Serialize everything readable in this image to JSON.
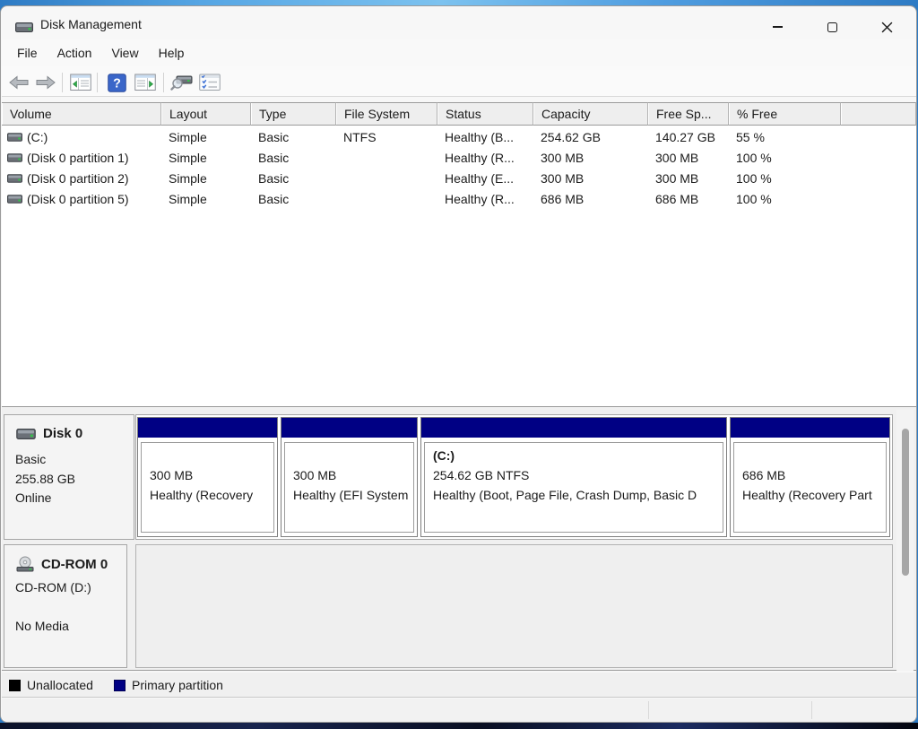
{
  "window": {
    "title": "Disk Management",
    "controls": {
      "minimize": "minimize",
      "maximize": "maximize",
      "close": "close"
    }
  },
  "menu": {
    "items": [
      {
        "label": "File"
      },
      {
        "label": "Action"
      },
      {
        "label": "View"
      },
      {
        "label": "Help"
      }
    ]
  },
  "toolbar": {
    "icons": [
      "back-icon",
      "forward-icon",
      "show-console-tree-icon",
      "help-icon",
      "show-action-pane-icon",
      "disk-search-icon",
      "checklist-icon"
    ]
  },
  "volume_table": {
    "columns": [
      {
        "label": "Volume"
      },
      {
        "label": "Layout"
      },
      {
        "label": "Type"
      },
      {
        "label": "File System"
      },
      {
        "label": "Status"
      },
      {
        "label": "Capacity"
      },
      {
        "label": "Free Sp..."
      },
      {
        "label": "% Free"
      }
    ],
    "rows": [
      {
        "volume": "(C:)",
        "layout": "Simple",
        "type": "Basic",
        "fs": "NTFS",
        "status": "Healthy (B...",
        "capacity": "254.62 GB",
        "free": "140.27 GB",
        "pct": "55 %"
      },
      {
        "volume": "(Disk 0 partition 1)",
        "layout": "Simple",
        "type": "Basic",
        "fs": "",
        "status": "Healthy (R...",
        "capacity": "300 MB",
        "free": "300 MB",
        "pct": "100 %"
      },
      {
        "volume": "(Disk 0 partition 2)",
        "layout": "Simple",
        "type": "Basic",
        "fs": "",
        "status": "Healthy (E...",
        "capacity": "300 MB",
        "free": "300 MB",
        "pct": "100 %"
      },
      {
        "volume": "(Disk 0 partition 5)",
        "layout": "Simple",
        "type": "Basic",
        "fs": "",
        "status": "Healthy (R...",
        "capacity": "686 MB",
        "free": "686 MB",
        "pct": "100 %"
      }
    ]
  },
  "graphical_view": {
    "disk0": {
      "title": "Disk 0",
      "lines": [
        "Basic",
        "255.88 GB",
        "Online"
      ],
      "partitions": [
        {
          "line1": "",
          "line2": "300 MB",
          "line3": "Healthy (Recovery"
        },
        {
          "line1": "",
          "line2": "300 MB",
          "line3": "Healthy (EFI System"
        },
        {
          "line1": "(C:)",
          "line2": "254.62 GB NTFS",
          "line3": "Healthy (Boot, Page File, Crash Dump, Basic D"
        },
        {
          "line1": "",
          "line2": "686 MB",
          "line3": "Healthy (Recovery Part"
        }
      ]
    },
    "cdrom": {
      "title": "CD-ROM 0",
      "line1": "CD-ROM (D:)",
      "line2": "No Media"
    }
  },
  "legend": {
    "items": [
      {
        "label": "Unallocated",
        "color": "#000000"
      },
      {
        "label": "Primary partition",
        "color": "#000084"
      }
    ]
  },
  "colors": {
    "primary_partition": "#000084",
    "desktop_top_blue": "#56a6e4",
    "panel_gray": "#f0f0f0",
    "led_green": "#35c04a"
  }
}
